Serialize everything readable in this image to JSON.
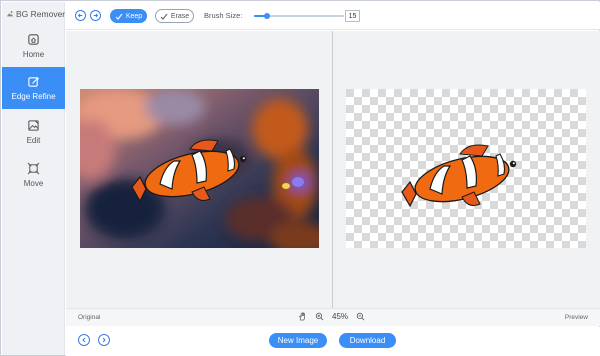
{
  "app": {
    "title": "BG Remover",
    "logo_icon": "bg-remover-logo"
  },
  "sidebar": {
    "items": [
      {
        "label": "Home",
        "icon": "home-icon",
        "active": false
      },
      {
        "label": "Edge Refine",
        "icon": "edge-refine-icon",
        "active": true
      },
      {
        "label": "Edit",
        "icon": "edit-image-icon",
        "active": false
      },
      {
        "label": "Move",
        "icon": "move-icon",
        "active": false
      }
    ]
  },
  "toolbar": {
    "undo_icon": "undo-icon",
    "redo_icon": "redo-icon",
    "keep_label": "Keep",
    "erase_label": "Erase",
    "brush_label": "Brush Size:",
    "brush_value": "15",
    "brush_level": 0.14
  },
  "canvas": {
    "original_content": "clownfish photo with coral background",
    "preview_content": "clownfish cutout on transparent background"
  },
  "statusbar": {
    "left_label": "Original",
    "right_label": "Preview",
    "zoom": "45%",
    "hand_icon": "hand-icon",
    "zoom_in_icon": "zoom-in-icon",
    "zoom_out_icon": "zoom-out-icon"
  },
  "bottombar": {
    "prev_icon": "previous-icon",
    "next_icon": "next-icon",
    "new_image_label": "New Image",
    "download_label": "Download"
  },
  "colors": {
    "accent": "#3a8ef6",
    "sidebar_bg": "#f0f1f4",
    "canvas_bg": "#f1f2f4",
    "fish_orange": "#f06a12"
  }
}
